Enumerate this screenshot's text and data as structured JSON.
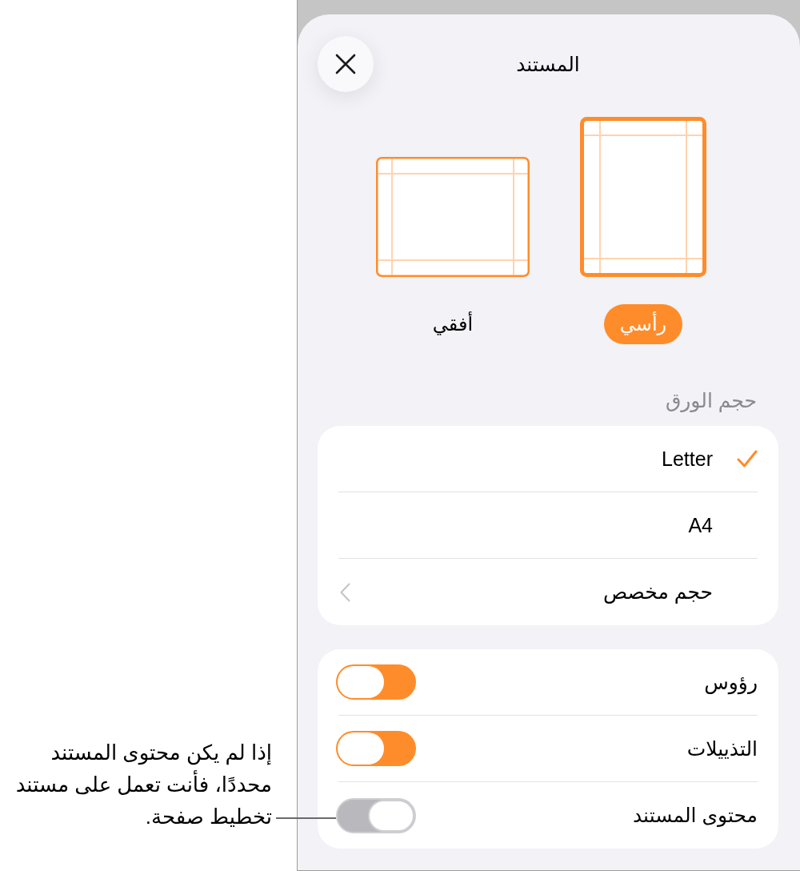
{
  "sheet": {
    "title": "المستند"
  },
  "orientations": [
    {
      "label": "رأسي",
      "kind": "portrait",
      "selected": true
    },
    {
      "label": "أفقي",
      "kind": "landscape",
      "selected": false
    }
  ],
  "paper_size": {
    "header": "حجم الورق",
    "options": [
      {
        "label": "Letter",
        "kind": "option",
        "selected": true
      },
      {
        "label": "A4",
        "kind": "option",
        "selected": false
      },
      {
        "label": "حجم مخصص",
        "kind": "submenu",
        "selected": false
      }
    ]
  },
  "toggles": [
    {
      "label": "رؤوس",
      "on": true
    },
    {
      "label": "التذييلات",
      "on": true
    },
    {
      "label": "محتوى المستند",
      "on": false
    }
  ],
  "callout": {
    "text": "إذا لم يكن محتوى المستند محددًا، فأنت تعمل على مستند تخطيط صفحة."
  }
}
